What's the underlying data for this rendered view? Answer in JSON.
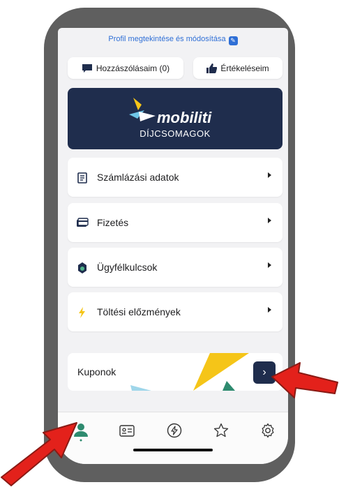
{
  "profile": {
    "link_label": "Profil megtekintése és módosítása"
  },
  "actions": {
    "comments_label": "Hozzászólásaim (0)",
    "ratings_label": "Értékeléseim"
  },
  "banner": {
    "brand": "mobiliti",
    "subtitle": "DÍJCSOMAGOK"
  },
  "menu": {
    "items": [
      {
        "label": "Számlázási adatok",
        "icon": "invoice-icon"
      },
      {
        "label": "Fizetés",
        "icon": "card-icon"
      },
      {
        "label": "Ügyfélkulcsok",
        "icon": "key-tag-icon"
      },
      {
        "label": "Töltési előzmények",
        "icon": "lightning-icon"
      }
    ]
  },
  "coupon": {
    "label": "Kuponok",
    "button_glyph": "›"
  },
  "tabbar": {
    "tabs": [
      {
        "icon": "person-icon",
        "active": true
      },
      {
        "icon": "id-card-icon",
        "active": false
      },
      {
        "icon": "charge-icon",
        "active": false
      },
      {
        "icon": "star-icon",
        "active": false
      },
      {
        "icon": "settings-icon",
        "active": false
      }
    ]
  },
  "colors": {
    "accent": "#2f6fd6",
    "navy": "#1f2d4d",
    "active_tab": "#2e8b6f",
    "arrow": "#e3211b",
    "yellow": "#f5c518"
  }
}
